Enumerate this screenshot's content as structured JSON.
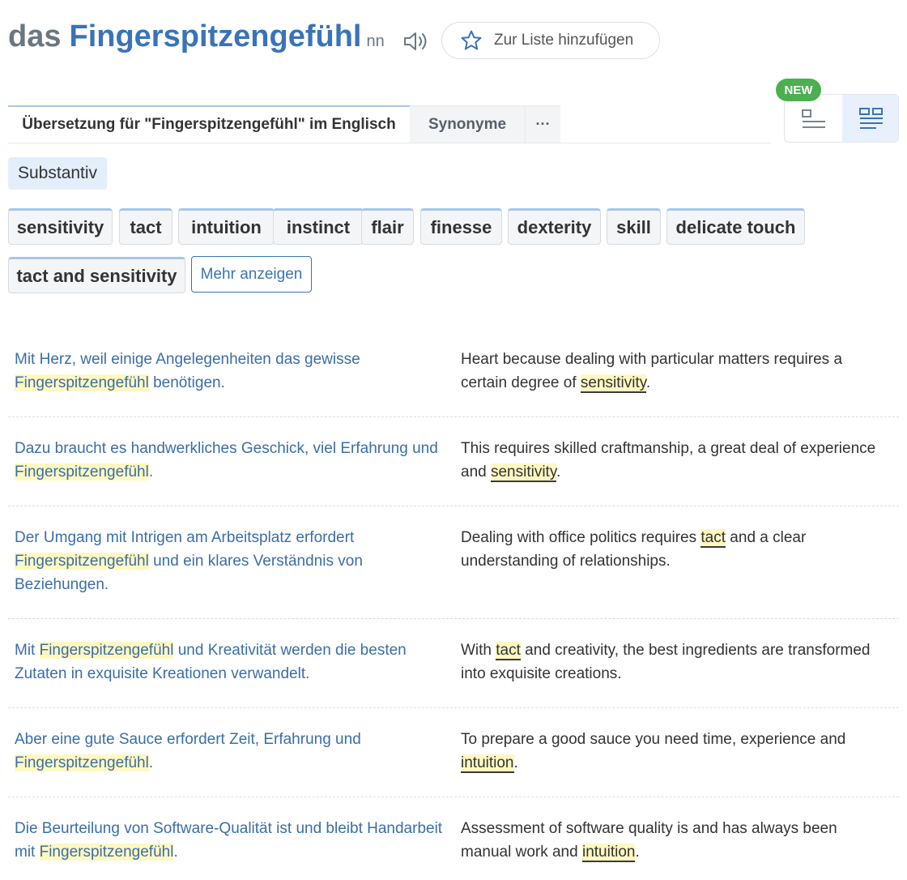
{
  "headword": {
    "article": "das",
    "term": "Fingerspitzengefühl",
    "gram": "nn",
    "speaker_icon": "speaker-icon",
    "add_list_label": "Zur Liste hinzufügen",
    "star_icon": "star-icon"
  },
  "tabs": {
    "translation": "Übersetzung für \"Fingerspitzengefühl\" im Englisch",
    "synonyms": "Synonyme",
    "more": "···"
  },
  "view_toggle": {
    "badge": "NEW",
    "left_icon": "compact-view-icon",
    "right_icon": "detailed-view-icon"
  },
  "pos": "Substantiv",
  "translations": [
    "sensitivity",
    "tact",
    "intuition",
    "instinct",
    "flair",
    "finesse",
    "dexterity",
    "skill",
    "delicate touch",
    "tact and sensitivity"
  ],
  "more_label": "Mehr anzeigen",
  "examples": [
    {
      "src": [
        "Mit Herz, weil einige Angelegenheiten das gewisse ",
        "Fingerspitzengefühl",
        " benötigen."
      ],
      "tgt": [
        "Heart because dealing with particular matters requires a certain degree of ",
        "sensitivity",
        "."
      ]
    },
    {
      "src": [
        "Dazu braucht es handwerkliches Geschick, viel Erfahrung und ",
        "Fingerspitzengefühl",
        "."
      ],
      "tgt": [
        "This requires skilled craftmanship, a great deal of experience and ",
        "sensitivity",
        "."
      ]
    },
    {
      "src": [
        "Der Umgang mit Intrigen am Arbeitsplatz erfordert ",
        "Fingerspitzengefühl",
        " und ein klares Verständnis von Beziehungen."
      ],
      "tgt": [
        "Dealing with office politics requires ",
        "tact",
        " and a clear understanding of relationships."
      ]
    },
    {
      "src": [
        "Mit ",
        "Fingerspitzengefühl",
        " und Kreativität werden die besten Zutaten in exquisite Kreationen verwandelt."
      ],
      "tgt": [
        "With ",
        "tact",
        " and creativity, the best ingredients are transformed into exquisite creations."
      ]
    },
    {
      "src": [
        "Aber eine gute Sauce erfordert Zeit, Erfahrung und ",
        "Fingerspitzengefühl",
        "."
      ],
      "tgt": [
        "To prepare a good sauce you need time, experience and ",
        "intuition",
        "."
      ]
    },
    {
      "src": [
        "Die Beurteilung von Software-Qualität ist und bleibt Handarbeit mit ",
        "Fingerspitzengefühl",
        "."
      ],
      "tgt": [
        "Assessment of software quality is and has always been manual work and ",
        "intuition",
        "."
      ]
    }
  ]
}
